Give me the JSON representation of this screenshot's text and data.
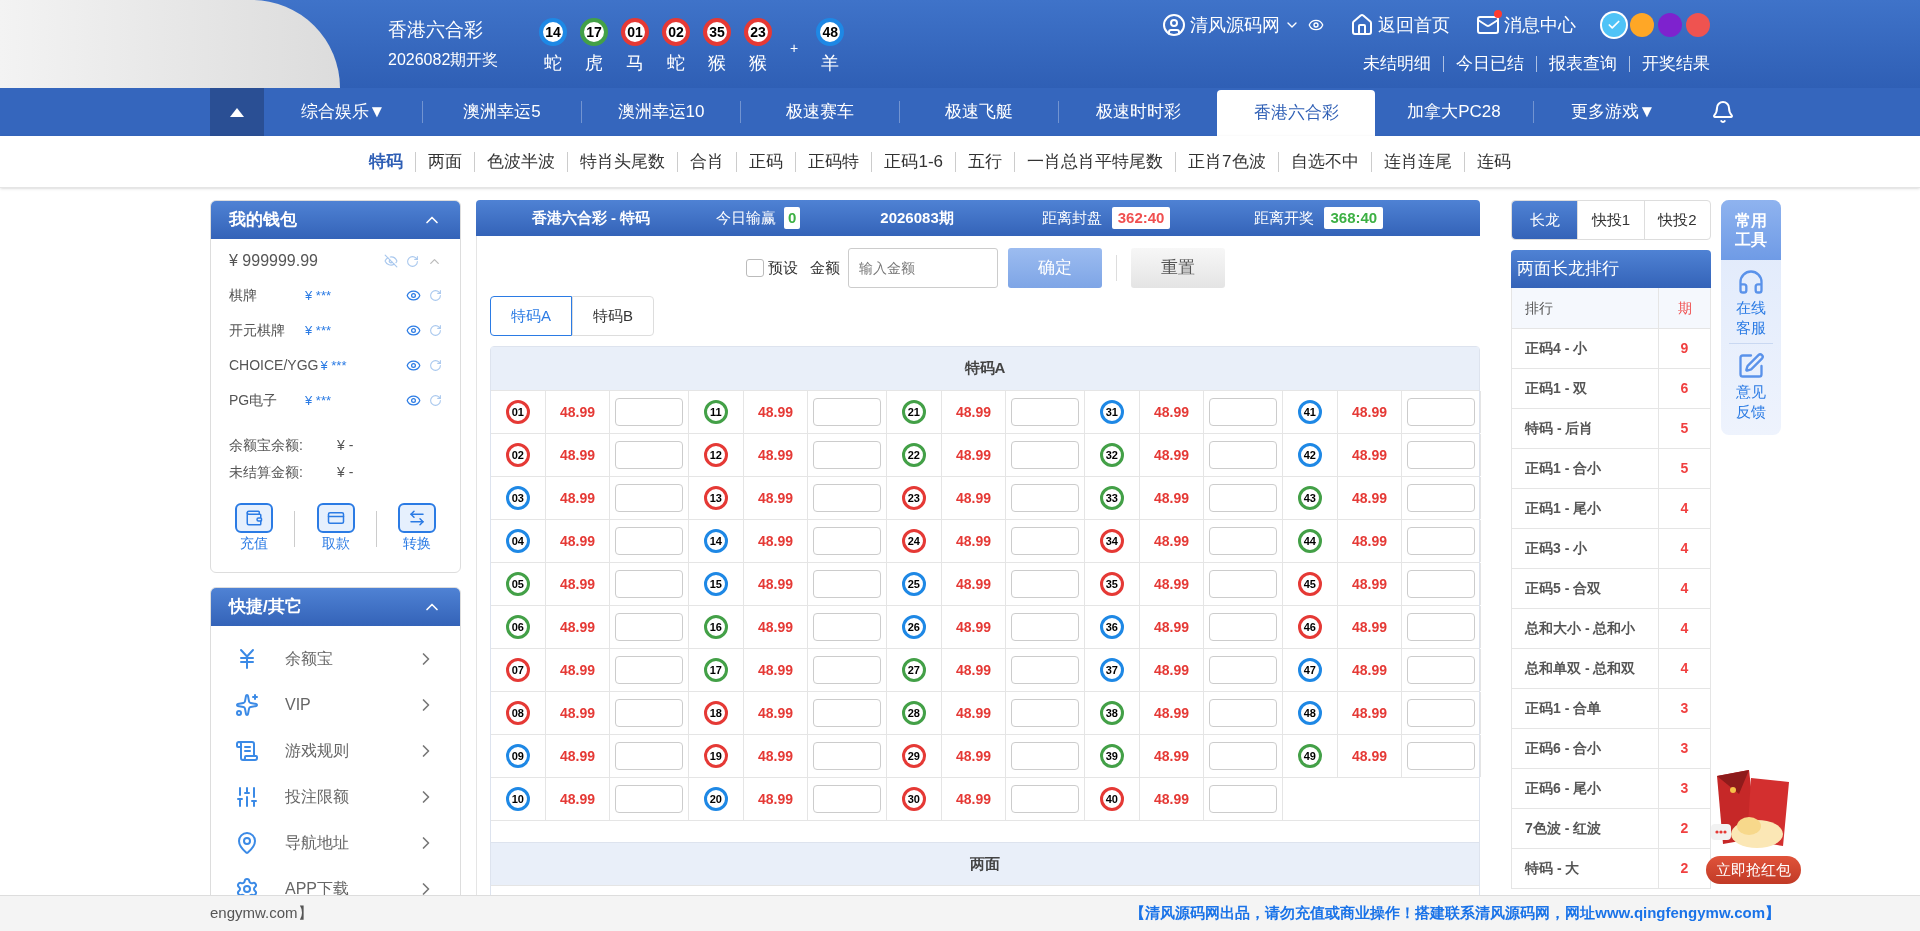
{
  "header": {
    "title": "香港六合彩",
    "period": "2026082期开奖",
    "balls": [
      {
        "number": "14",
        "zodiac": "蛇",
        "color": "#1e88e5"
      },
      {
        "number": "17",
        "zodiac": "虎",
        "color": "#43a047"
      },
      {
        "number": "01",
        "zodiac": "马",
        "color": "#e53935"
      },
      {
        "number": "02",
        "zodiac": "蛇",
        "color": "#e53935"
      },
      {
        "number": "35",
        "zodiac": "猴",
        "color": "#e53935"
      },
      {
        "number": "23",
        "zodiac": "猴",
        "color": "#e53935"
      }
    ],
    "plus": "+",
    "special": {
      "number": "48",
      "zodiac": "羊",
      "color": "#1e88e5"
    },
    "user": "清风源码网",
    "links": [
      {
        "label": "返回首页",
        "kind": "home",
        "badge": false
      },
      {
        "label": "消息中心",
        "kind": "mail",
        "badge": true
      }
    ],
    "themes": [
      {
        "color": "#4fc3f7",
        "selected": true
      },
      {
        "color": "#ffa726",
        "selected": false
      },
      {
        "color": "#7e22ce",
        "selected": false
      },
      {
        "color": "#ef5350",
        "selected": false
      }
    ],
    "sublinks": [
      "未结明细",
      "今日已结",
      "报表查询",
      "开奖结果"
    ]
  },
  "nav": [
    {
      "label": "综合娱乐▼",
      "selected": false
    },
    {
      "label": "澳洲幸运5",
      "selected": false
    },
    {
      "label": "澳洲幸运10",
      "selected": false
    },
    {
      "label": "极速赛车",
      "selected": false
    },
    {
      "label": "极速飞艇",
      "selected": false
    },
    {
      "label": "极速时时彩",
      "selected": false
    },
    {
      "label": "香港六合彩",
      "selected": true
    },
    {
      "label": "加拿大PC28",
      "selected": false
    },
    {
      "label": "更多游戏▼",
      "selected": false
    }
  ],
  "subnav": [
    {
      "label": "特码",
      "selected": true
    },
    {
      "label": "两面",
      "selected": false
    },
    {
      "label": "色波半波",
      "selected": false
    },
    {
      "label": "特肖头尾数",
      "selected": false
    },
    {
      "label": "合肖",
      "selected": false
    },
    {
      "label": "正码",
      "selected": false
    },
    {
      "label": "正码特",
      "selected": false
    },
    {
      "label": "正码1-6",
      "selected": false
    },
    {
      "label": "五行",
      "selected": false
    },
    {
      "label": "一肖总肖平特尾数",
      "selected": false
    },
    {
      "label": "正肖7色波",
      "selected": false
    },
    {
      "label": "自选不中",
      "selected": false
    },
    {
      "label": "连肖连尾",
      "selected": false
    },
    {
      "label": "连码",
      "selected": false
    }
  ],
  "wallet": {
    "title": "我的钱包",
    "balance": "¥ 999999.99",
    "accounts": [
      {
        "name": "棋牌",
        "amount": "¥ ***"
      },
      {
        "name": "开元棋牌",
        "amount": "¥ ***"
      },
      {
        "name": "CHOICE/YGG",
        "amount": "¥ ***"
      },
      {
        "name": "PG电子",
        "amount": "¥ ***"
      }
    ],
    "summary": [
      {
        "label": "余额宝余额:",
        "value": "¥ -"
      },
      {
        "label": "未结算金额:",
        "value": "¥ -"
      }
    ],
    "actions": [
      {
        "label": "充值",
        "kind": "deposit"
      },
      {
        "label": "取款",
        "kind": "withdraw"
      },
      {
        "label": "转换",
        "kind": "transfer"
      }
    ]
  },
  "quick": {
    "title": "快捷/其它",
    "items": [
      {
        "label": "余额宝",
        "kind": "yen"
      },
      {
        "label": "VIP",
        "kind": "vip"
      },
      {
        "label": "游戏规则",
        "kind": "rules"
      },
      {
        "label": "投注限额",
        "kind": "limits"
      },
      {
        "label": "导航地址",
        "kind": "map"
      },
      {
        "label": "APP下载",
        "kind": "gear"
      }
    ]
  },
  "game": {
    "title": "香港六合彩 - 特码",
    "today_label": "今日输赢",
    "today_value": "0",
    "period": "2026083期",
    "close_label": "距离封盘",
    "close_time": "362:40",
    "open_label": "距离开奖",
    "open_time": "368:40",
    "preset": {
      "label": "预设",
      "checked": false
    },
    "amount_label": "金额",
    "amount_placeholder": "输入金额",
    "confirm": "确定",
    "reset": "重置",
    "tabs": [
      {
        "label": "特码A",
        "selected": true
      },
      {
        "label": "特码B",
        "selected": false
      }
    ],
    "table_title": "特码A",
    "odds": [
      {
        "number": "01",
        "color": "#e53935",
        "odds": "48.99"
      },
      {
        "number": "02",
        "color": "#e53935",
        "odds": "48.99"
      },
      {
        "number": "03",
        "color": "#1e88e5",
        "odds": "48.99"
      },
      {
        "number": "04",
        "color": "#1e88e5",
        "odds": "48.99"
      },
      {
        "number": "05",
        "color": "#43a047",
        "odds": "48.99"
      },
      {
        "number": "06",
        "color": "#43a047",
        "odds": "48.99"
      },
      {
        "number": "07",
        "color": "#e53935",
        "odds": "48.99"
      },
      {
        "number": "08",
        "color": "#e53935",
        "odds": "48.99"
      },
      {
        "number": "09",
        "color": "#1e88e5",
        "odds": "48.99"
      },
      {
        "number": "10",
        "color": "#1e88e5",
        "odds": "48.99"
      },
      {
        "number": "11",
        "color": "#43a047",
        "odds": "48.99"
      },
      {
        "number": "12",
        "color": "#e53935",
        "odds": "48.99"
      },
      {
        "number": "13",
        "color": "#e53935",
        "odds": "48.99"
      },
      {
        "number": "14",
        "color": "#1e88e5",
        "odds": "48.99"
      },
      {
        "number": "15",
        "color": "#1e88e5",
        "odds": "48.99"
      },
      {
        "number": "16",
        "color": "#43a047",
        "odds": "48.99"
      },
      {
        "number": "17",
        "color": "#43a047",
        "odds": "48.99"
      },
      {
        "number": "18",
        "color": "#e53935",
        "odds": "48.99"
      },
      {
        "number": "19",
        "color": "#e53935",
        "odds": "48.99"
      },
      {
        "number": "20",
        "color": "#1e88e5",
        "odds": "48.99"
      },
      {
        "number": "21",
        "color": "#43a047",
        "odds": "48.99"
      },
      {
        "number": "22",
        "color": "#43a047",
        "odds": "48.99"
      },
      {
        "number": "23",
        "color": "#e53935",
        "odds": "48.99"
      },
      {
        "number": "24",
        "color": "#e53935",
        "odds": "48.99"
      },
      {
        "number": "25",
        "color": "#1e88e5",
        "odds": "48.99"
      },
      {
        "number": "26",
        "color": "#1e88e5",
        "odds": "48.99"
      },
      {
        "number": "27",
        "color": "#43a047",
        "odds": "48.99"
      },
      {
        "number": "28",
        "color": "#43a047",
        "odds": "48.99"
      },
      {
        "number": "29",
        "color": "#e53935",
        "odds": "48.99"
      },
      {
        "number": "30",
        "color": "#e53935",
        "odds": "48.99"
      },
      {
        "number": "31",
        "color": "#1e88e5",
        "odds": "48.99"
      },
      {
        "number": "32",
        "color": "#43a047",
        "odds": "48.99"
      },
      {
        "number": "33",
        "color": "#43a047",
        "odds": "48.99"
      },
      {
        "number": "34",
        "color": "#e53935",
        "odds": "48.99"
      },
      {
        "number": "35",
        "color": "#e53935",
        "odds": "48.99"
      },
      {
        "number": "36",
        "color": "#1e88e5",
        "odds": "48.99"
      },
      {
        "number": "37",
        "color": "#1e88e5",
        "odds": "48.99"
      },
      {
        "number": "38",
        "color": "#43a047",
        "odds": "48.99"
      },
      {
        "number": "39",
        "color": "#43a047",
        "odds": "48.99"
      },
      {
        "number": "40",
        "color": "#e53935",
        "odds": "48.99"
      },
      {
        "number": "41",
        "color": "#1e88e5",
        "odds": "48.99"
      },
      {
        "number": "42",
        "color": "#1e88e5",
        "odds": "48.99"
      },
      {
        "number": "43",
        "color": "#43a047",
        "odds": "48.99"
      },
      {
        "number": "44",
        "color": "#43a047",
        "odds": "48.99"
      },
      {
        "number": "45",
        "color": "#e53935",
        "odds": "48.99"
      },
      {
        "number": "46",
        "color": "#e53935",
        "odds": "48.99"
      },
      {
        "number": "47",
        "color": "#1e88e5",
        "odds": "48.99"
      },
      {
        "number": "48",
        "color": "#1e88e5",
        "odds": "48.99"
      },
      {
        "number": "49",
        "color": "#43a047",
        "odds": "48.99"
      }
    ],
    "next_section": "两面"
  },
  "dragon": {
    "tabs": [
      {
        "label": "长龙",
        "selected": true
      },
      {
        "label": "快投1",
        "selected": false
      },
      {
        "label": "快投2",
        "selected": false
      }
    ],
    "title": "两面长龙排行",
    "columns": [
      "排行",
      "期"
    ],
    "rows": [
      {
        "name": "正码4 - 小",
        "count": "9"
      },
      {
        "name": "正码1 - 双",
        "count": "6"
      },
      {
        "name": "特码 - 后肖",
        "count": "5"
      },
      {
        "name": "正码1 - 合小",
        "count": "5"
      },
      {
        "name": "正码1 - 尾小",
        "count": "4"
      },
      {
        "name": "正码3 - 小",
        "count": "4"
      },
      {
        "name": "正码5 - 合双",
        "count": "4"
      },
      {
        "name": "总和大小 - 总和小",
        "count": "4"
      },
      {
        "name": "总和单双 - 总和双",
        "count": "4"
      },
      {
        "name": "正码1 - 合单",
        "count": "3"
      },
      {
        "name": "正码6 - 合小",
        "count": "3"
      },
      {
        "name": "正码6 - 尾小",
        "count": "3"
      },
      {
        "name": "7色波 - 红波",
        "count": "2"
      },
      {
        "name": "特码 - 大",
        "count": "2"
      }
    ]
  },
  "tools": {
    "title": "常用工具",
    "items": [
      {
        "label": "在线客服",
        "kind": "service"
      },
      {
        "label": "意见反馈",
        "kind": "feedback"
      }
    ]
  },
  "red_packet": {
    "label": "立即抢红包"
  },
  "footer": {
    "left": "engymw.com】",
    "notice": "【清风源码网出品，请勿充值或商业操作！搭建联系清风源码网，网址www.qingfengymw.com】"
  }
}
